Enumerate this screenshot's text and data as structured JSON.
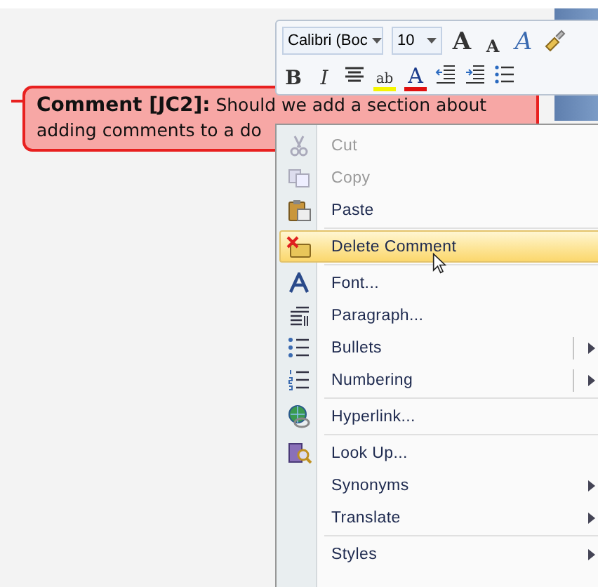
{
  "comment": {
    "lines": [
      "**Comment [JC2]:** Should we add a section about",
      "adding comments to a do"
    ]
  },
  "mini_toolbar": {
    "font": {
      "value": "Calibri (Boc"
    },
    "size": {
      "value": "10"
    },
    "buttons": [
      {
        "kind": "grow",
        "glyph": "A"
      },
      {
        "kind": "shrink",
        "glyph": "A"
      },
      {
        "kind": "styles",
        "glyph": "A"
      },
      {
        "kind": "painter"
      },
      {
        "kind": "bold",
        "glyph": "B"
      },
      {
        "kind": "italic",
        "glyph": "I"
      },
      {
        "kind": "center"
      },
      {
        "kind": "highlight",
        "glyph": "ab"
      },
      {
        "kind": "color",
        "glyph": "A"
      },
      {
        "kind": "outdent"
      },
      {
        "kind": "indent"
      },
      {
        "kind": "bullets"
      }
    ]
  },
  "context_menu": {
    "items": [
      {
        "label": "Cut",
        "disabled": true,
        "selected": false,
        "submenu": false,
        "separator_after": false
      },
      {
        "label": "Copy",
        "disabled": true,
        "selected": false,
        "submenu": false,
        "separator_after": false
      },
      {
        "label": "Paste",
        "disabled": false,
        "selected": false,
        "submenu": false,
        "separator_after": true
      },
      {
        "label": "Delete Comment",
        "disabled": false,
        "selected": true,
        "submenu": false,
        "separator_after": true
      },
      {
        "label": "Font...",
        "disabled": false,
        "selected": false,
        "submenu": false,
        "separator_after": false
      },
      {
        "label": "Paragraph...",
        "disabled": false,
        "selected": false,
        "submenu": false,
        "separator_after": false
      },
      {
        "label": "Bullets",
        "disabled": false,
        "selected": false,
        "submenu": true,
        "separator_after": false
      },
      {
        "label": "Numbering",
        "disabled": false,
        "selected": false,
        "submenu": true,
        "separator_after": true
      },
      {
        "label": "Hyperlink...",
        "disabled": false,
        "selected": false,
        "submenu": false,
        "separator_after": true
      },
      {
        "label": "Look Up...",
        "disabled": false,
        "selected": false,
        "submenu": false,
        "separator_after": false
      },
      {
        "label": "Synonyms",
        "disabled": false,
        "selected": false,
        "submenu": true,
        "separator_after": false
      },
      {
        "label": "Translate",
        "disabled": false,
        "selected": false,
        "submenu": true,
        "separator_after": true
      },
      {
        "label": "Styles",
        "disabled": false,
        "selected": false,
        "submenu": true,
        "separator_after": false
      }
    ]
  }
}
